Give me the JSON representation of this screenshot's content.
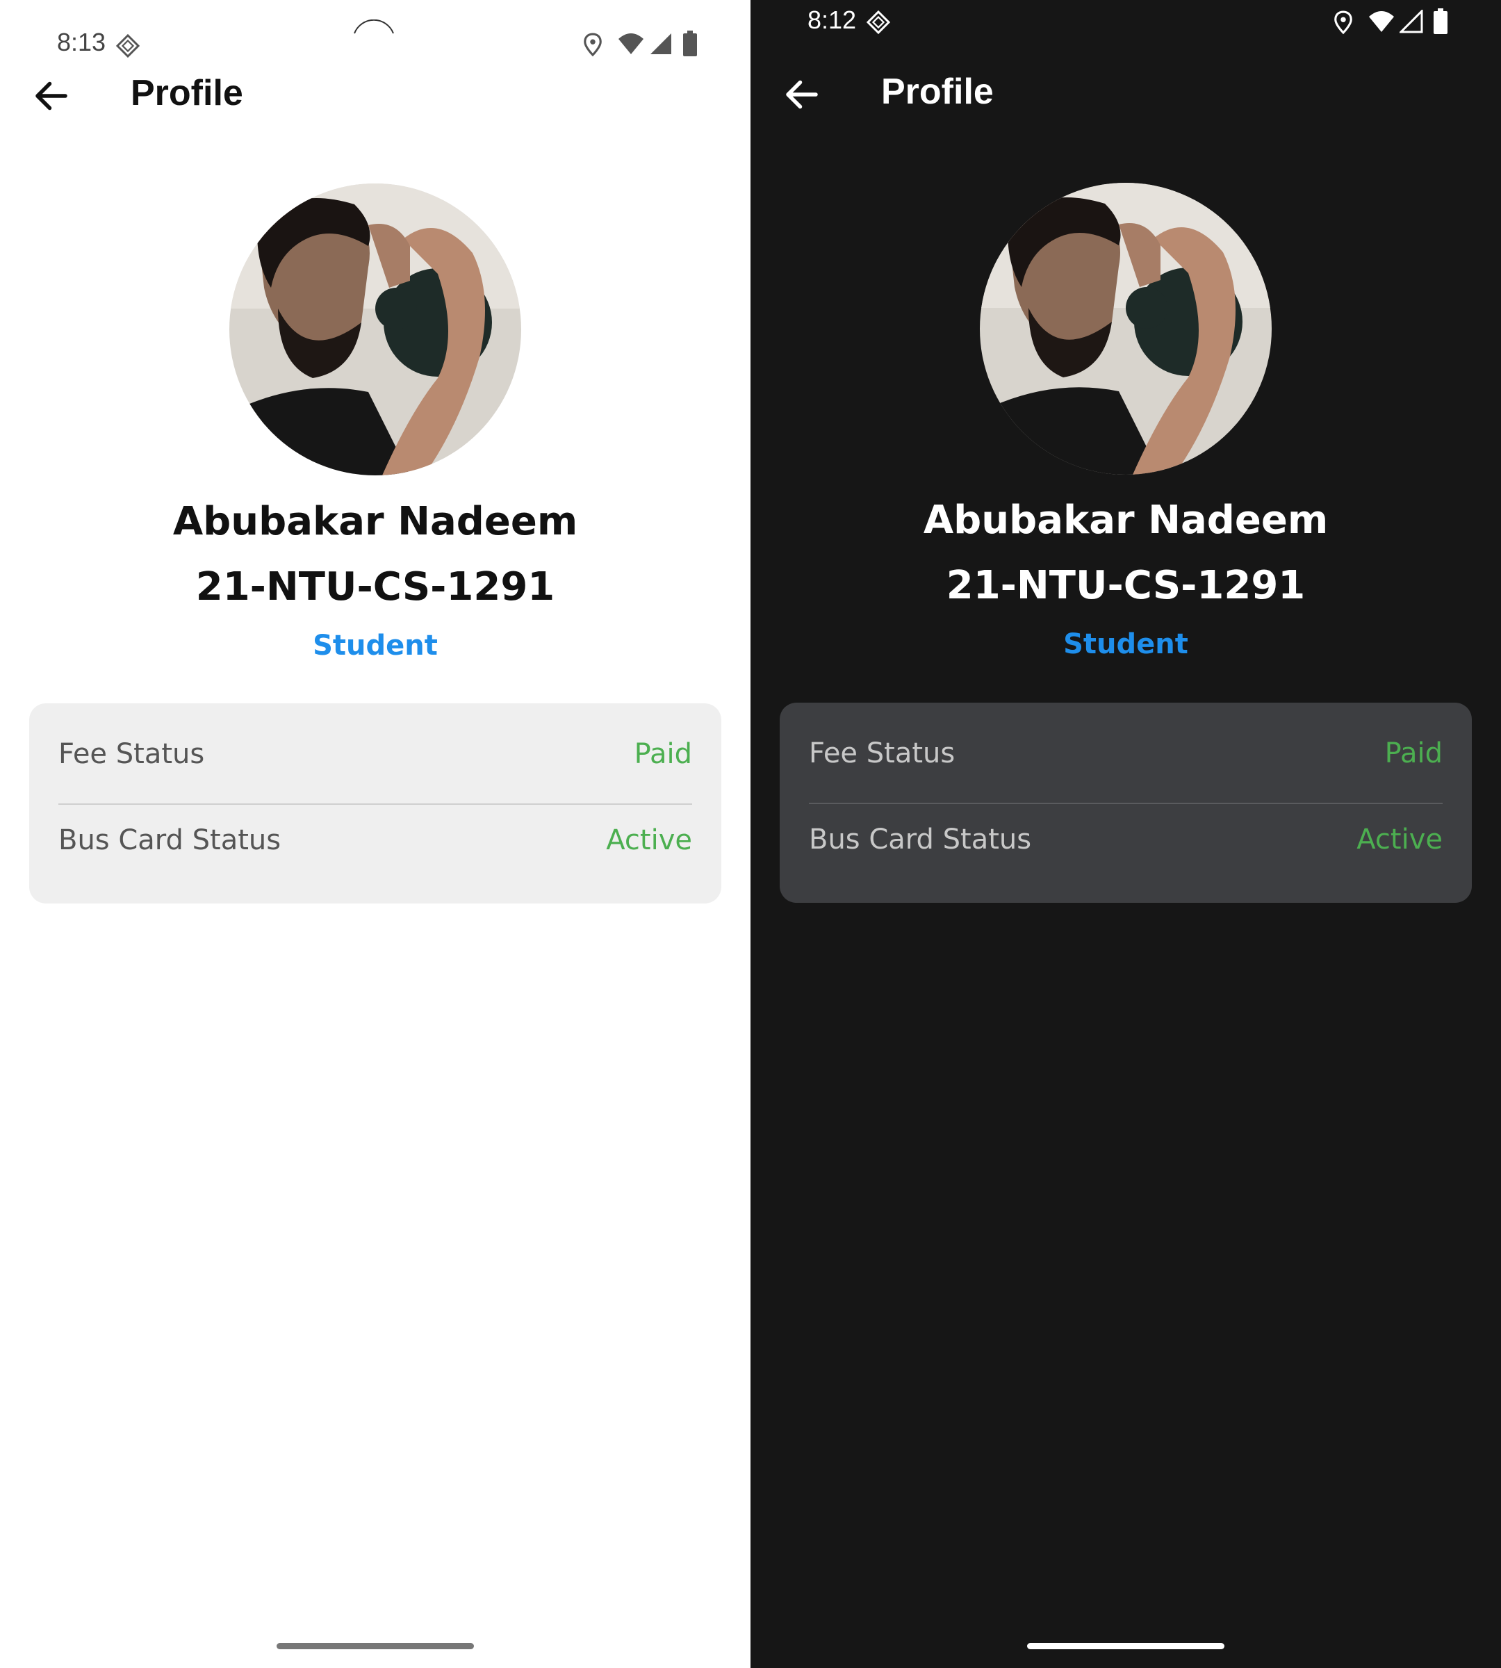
{
  "screens": [
    {
      "theme": "light",
      "status_bar": {
        "time": "8:13"
      },
      "app_bar": {
        "title": "Profile"
      },
      "profile": {
        "name": "Abubakar Nadeem",
        "registration": "21-NTU-CS-1291",
        "role": "Student"
      },
      "details": [
        {
          "label": "Fee Status",
          "value": "Paid"
        },
        {
          "label": "Bus Card Status",
          "value": "Active"
        }
      ]
    },
    {
      "theme": "dark",
      "status_bar": {
        "time": "8:12"
      },
      "app_bar": {
        "title": "Profile"
      },
      "profile": {
        "name": "Abubakar Nadeem",
        "registration": "21-NTU-CS-1291",
        "role": "Student"
      },
      "details": [
        {
          "label": "Fee Status",
          "value": "Paid"
        },
        {
          "label": "Bus Card Status",
          "value": "Active"
        }
      ]
    }
  ],
  "colors": {
    "accent": "#1E8EEB",
    "status_green": "#4CAF50",
    "dark_bg": "#161616",
    "dark_card": "#3D3E41",
    "light_card": "#EFEFEF"
  },
  "icons": [
    "back-arrow-icon",
    "location-icon",
    "wifi-icon",
    "signal-icon",
    "battery-icon",
    "diamond-notification-icon"
  ]
}
